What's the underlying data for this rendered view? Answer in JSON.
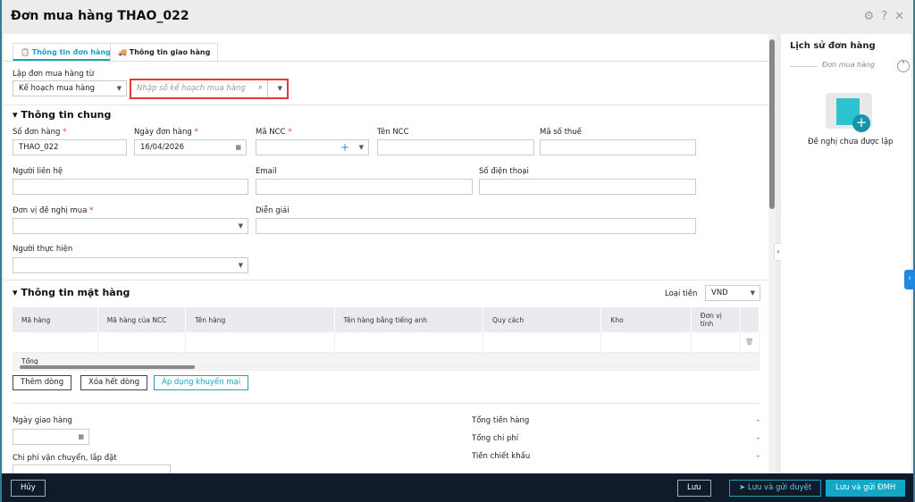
{
  "window": {
    "title": "Đơn mua hàng THAO_022"
  },
  "tabs": [
    "Thông tin đơn hàng",
    "Thông tin giao hàng"
  ],
  "source": {
    "label": "Lập đơn mua hàng từ",
    "value": "Kế hoạch mua hàng",
    "search_placeholder": "Nhập số kế hoạch mua hàng"
  },
  "general": {
    "title": "Thông tin chung",
    "order_no_label": "Số đơn hàng",
    "order_no": "THAO_022",
    "order_date_label": "Ngày đơn hàng",
    "order_date": "16/04/2026",
    "supplier_code_label": "Mã NCC",
    "supplier_name_label": "Tên NCC",
    "tax_code_label": "Mã số thuế",
    "contact_label": "Người liên hệ",
    "email_label": "Email",
    "phone_label": "Số điện thoại",
    "request_unit_label": "Đơn vị đề nghị mua",
    "description_label": "Diễn giải",
    "executor_label": "Người thực hiện",
    "required_mark": "*"
  },
  "items": {
    "title": "Thông tin mặt hàng",
    "currency_label": "Loại tiền",
    "currency": "VND",
    "columns": [
      "Mã hàng",
      "Mã hàng của NCC",
      "Tên hàng",
      "Tên hàng bằng tiếng anh",
      "Quy cách",
      "Kho",
      "Đơn vị tính"
    ],
    "total_label": "Tổng",
    "add_row": "Thêm dòng",
    "clear_rows": "Xóa hết dòng",
    "apply_promo": "Áp dụng khuyến mại"
  },
  "bottom": {
    "delivery_date_label": "Ngày giao hàng",
    "shipping_cost_label": "Chi phí vận chuyển, lắp đặt",
    "summary": [
      {
        "label": "Tổng tiền hàng",
        "value": "-"
      },
      {
        "label": "Tổng chi phí",
        "value": "-"
      },
      {
        "label": "Tiền chiết khấu",
        "value": "-"
      }
    ]
  },
  "history": {
    "title": "Lịch sử đơn hàng",
    "subtitle": "Đơn mua hàng",
    "empty": "Đề nghị chưa được lập"
  },
  "footer": {
    "cancel": "Hủy",
    "save": "Lưu",
    "save_send_approve": "Lưu và gửi duyệt",
    "save_send_dmh": "Lưu và gửi ĐMH"
  }
}
